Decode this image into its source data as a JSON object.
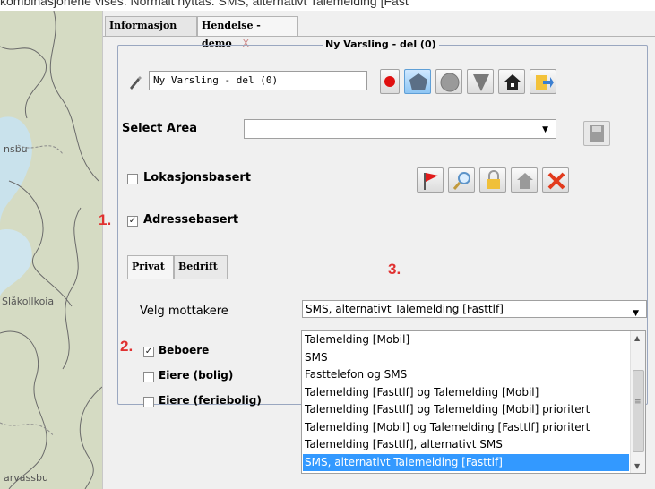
{
  "top_text": "kombinasjonene vises. Normalt nyttas: SMS, alternativt Talemelding [Fast",
  "map": {
    "labels": [
      "nsbu",
      "Slåkollkoia",
      "arvassbu"
    ]
  },
  "tabs": [
    {
      "label": "Informasjon",
      "active": false
    },
    {
      "label": "Hendelse - demo",
      "active": true,
      "close": "X"
    }
  ],
  "group_title": "Ny Varsling - del (0)",
  "name_field": {
    "value": "Ny Varsling - del (0)"
  },
  "select_area": {
    "label": "Select Area",
    "value": ""
  },
  "lokasjonsbasert": {
    "label": "Lokasjonsbasert",
    "checked": false
  },
  "adressebasert": {
    "label": "Adressebasert",
    "checked": true
  },
  "subtabs": [
    {
      "label": "Privat"
    },
    {
      "label": "Bedrift"
    }
  ],
  "annotations": {
    "one": "1.",
    "two": "2.",
    "three": "3."
  },
  "velg_mottakere": {
    "label": "Velg mottakere",
    "value": "SMS, alternativt Talemelding [Fasttlf]",
    "options": [
      "Talemelding [Mobil]",
      "SMS",
      "Fasttelefon og SMS",
      "Talemelding [Fasttlf] og Talemelding [Mobil]",
      "Talemelding [Fasttlf] og Talemelding [Mobil] prioritert",
      "Talemelding [Mobil] og Talemelding [Fasttlf] prioritert",
      "Talemelding [Fasttlf], alternativt SMS",
      "SMS, alternativt Talemelding [Fasttlf]"
    ],
    "selected_index": 7
  },
  "recipients": [
    {
      "label": "Beboere",
      "checked": true
    },
    {
      "label": "Eiere (bolig)",
      "checked": false
    },
    {
      "label": "Eiere (feriebolig)",
      "checked": false
    }
  ],
  "colors": {
    "accent": "#3399ff",
    "annotation": "#e03131"
  }
}
